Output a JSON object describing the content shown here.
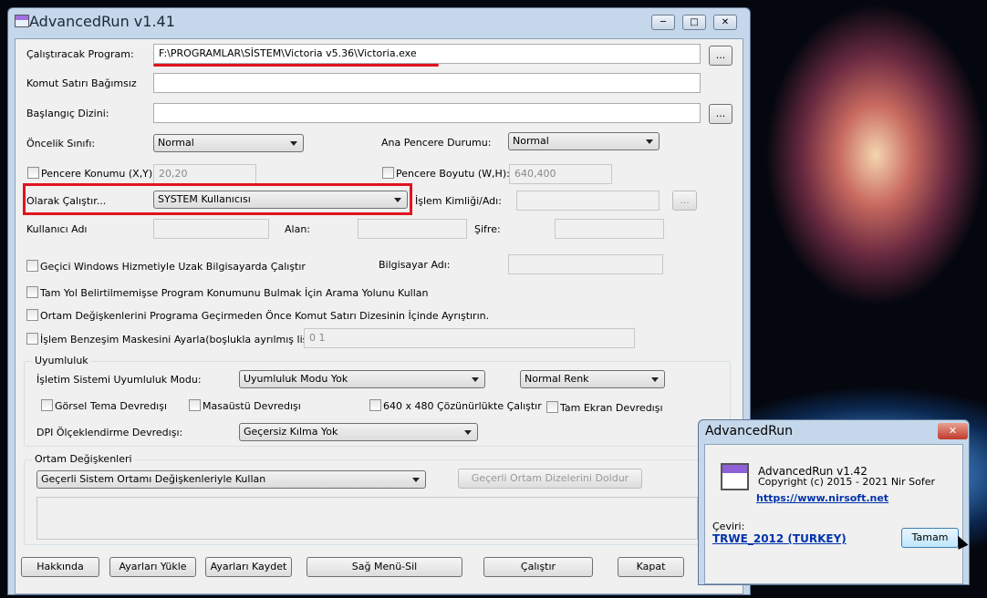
{
  "window": {
    "title": "AdvancedRun v1.41"
  },
  "fields": {
    "program_label": "Çalıştıracak Program:",
    "program_value": "F:\\PROGRAMLAR\\SİSTEM\\Victoria v5.36\\Victoria.exe",
    "cmdline_label": "Komut Satırı Bağımsız",
    "cmdline_value": "",
    "startdir_label": "Başlangıç Dizini:",
    "startdir_value": "",
    "priority_label": "Öncelik Sınıfı:",
    "priority_value": "Normal",
    "mainwin_label": "Ana Pencere Durumu:",
    "mainwin_value": "Normal",
    "winpos_label": "Pencere Konumu (X,Y):",
    "winpos_value": "20,20",
    "winsize_label": "Pencere Boyutu (W,H):",
    "winsize_value": "640,400",
    "runas_label": "Olarak Çalıştır...",
    "runas_value": "SYSTEM Kullanıcısı",
    "process_label": "İşlem Kimliği/Adı:",
    "process_value": "",
    "username_label": "Kullanıcı Adı",
    "domain_label": "Alan:",
    "password_label": "Şifre:",
    "remote_label": "Geçici Windows Hizmetiyle Uzak Bilgisayarda Çalıştır",
    "computer_label": "Bilgisayar Adı:",
    "searchpath_label": "Tam Yol Belirtilmemişse Program Konumunu Bulmak İçin Arama Yolunu Kullan",
    "parseenv_label": "Ortam Değişkenlerini Programa Geçirmeden Önce Komut Satırı Dizesinin İçinde Ayrıştırın.",
    "affinity_label": "İşlem Benzeşim Maskesini Ayarla(boşlukla ayrılmış liste):",
    "affinity_value": "0 1",
    "browse": "...",
    "browse_small": "..."
  },
  "compat": {
    "group": "Uyumluluk",
    "os_label": "İşletim Sistemi Uyumluluk Modu:",
    "os_value": "Uyumluluk Modu Yok",
    "color_value": "Normal Renk",
    "theme": "Görsel Tema Devredışı",
    "desktop": "Masaüstü  Devredışı",
    "res640": "640 x 480 Çözünürlükte Çalıştır",
    "fullscreen": "Tam Ekran Devredışı",
    "dpi_label": "DPI Ölçeklendirme Devredışı:",
    "dpi_value": "Geçersiz Kılma Yok"
  },
  "env": {
    "group": "Ortam Değişkenleri",
    "mode_value": "Geçerli Sistem Ortamı Değişkenleriyle Kullan",
    "fill_button": "Geçerli Ortam Dizelerini Doldur"
  },
  "buttons": {
    "about": "Hakkında",
    "load": "Ayarları Yükle",
    "save": "Ayarları Kaydet",
    "context": "Sağ Menü-Sil",
    "run": "Çalıştır",
    "close": "Kapat"
  },
  "about": {
    "title": "AdvancedRun",
    "version": "AdvancedRun v1.42",
    "copyright": "Copyright (c) 2015 - 2021 Nir Sofer",
    "url": "https://www.nirsoft.net",
    "translation_label": "Çeviri:",
    "translator": "TRWE_2012 (TURKEY)",
    "ok": "Tamam"
  },
  "colors": {
    "highlight": "#e0141e",
    "link": "#0033aa"
  }
}
